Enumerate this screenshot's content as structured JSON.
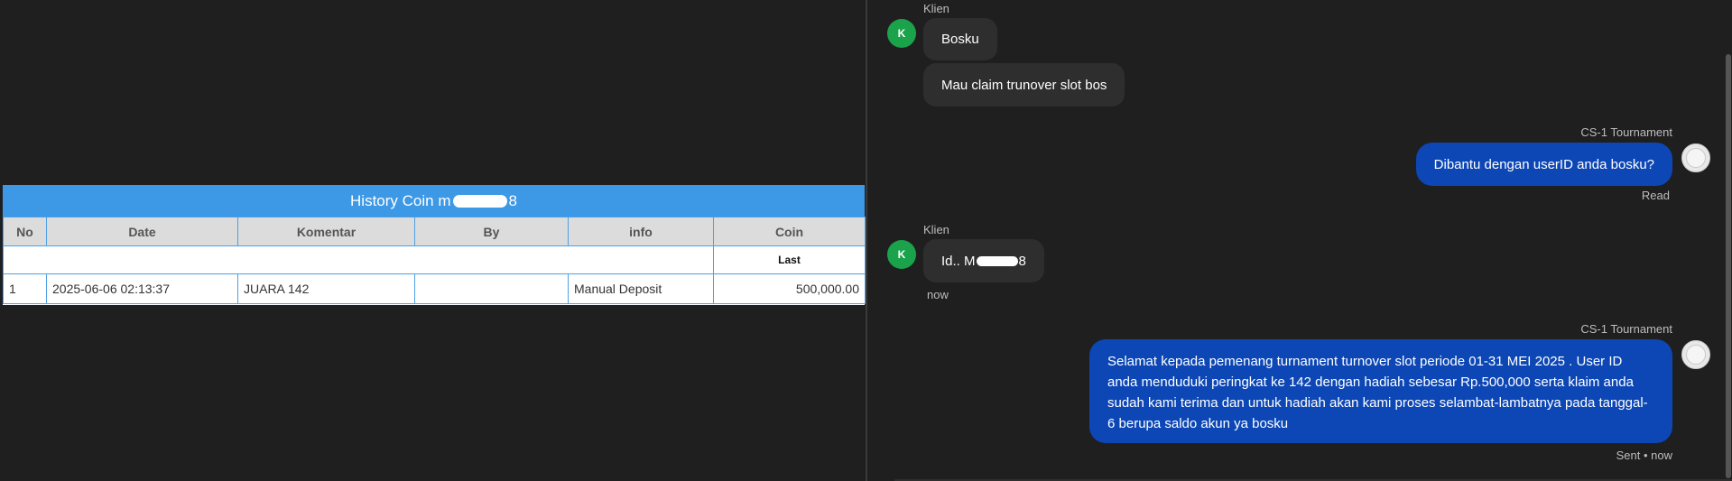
{
  "history": {
    "title_prefix": "History Coin m",
    "title_suffix": "8",
    "columns": [
      "No",
      "Date",
      "Komentar",
      "By",
      "info",
      "Coin"
    ],
    "sub_label": "Last",
    "rows": [
      {
        "no": "1",
        "date": "2025-06-06 02:13:37",
        "komentar": "JUARA 142",
        "by": "",
        "info": "Manual Deposit",
        "coin": "500,000.00"
      }
    ]
  },
  "chat": {
    "msg1": {
      "sender": "Klien",
      "avatar_letter": "K",
      "bubble1": "Bosku",
      "bubble2": "Mau claim trunover slot bos"
    },
    "msg2": {
      "sender": "CS-1 Tournament",
      "text": "Dibantu dengan userID anda bosku?",
      "status": "Read"
    },
    "msg3": {
      "sender": "Klien",
      "avatar_letter": "K",
      "text_prefix": "Id.. M",
      "text_suffix": "8",
      "time": "now"
    },
    "msg4": {
      "sender": "CS-1 Tournament",
      "text": "Selamat kepada pemenang turnament turnover slot periode 01-31 MEI 2025 . User ID anda menduduki peringkat ke 142 dengan hadiah sebesar Rp.500,000 serta klaim anda sudah kami terima dan untuk hadiah akan kami proses selambat-lambatnya pada tanggal- 6 berupa saldo akun ya bosku",
      "status": "Sent • now"
    }
  },
  "colors": {
    "table_header": "#3d98e6",
    "out_bubble": "#0d47b5",
    "in_bubble": "#2e2e2e",
    "avatar_green": "#1aa34a",
    "coin_green": "#2e8b2e"
  }
}
